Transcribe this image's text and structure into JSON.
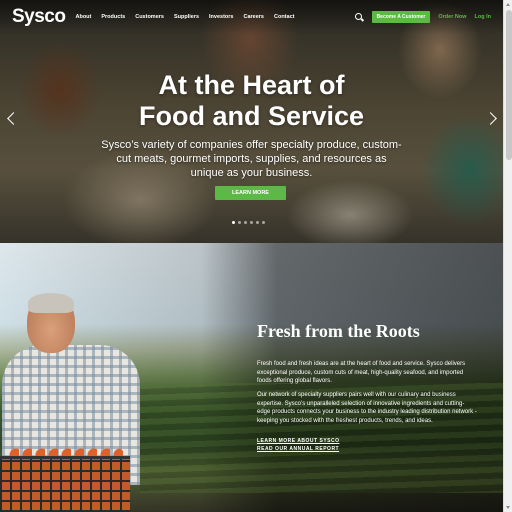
{
  "nav": {
    "logo": "Sysco",
    "links": [
      "About",
      "Products",
      "Customers",
      "Suppliers",
      "Investors",
      "Careers",
      "Contact"
    ],
    "become_customer": "Become A Customer",
    "order_now": "Order Now",
    "log_in": "Log In"
  },
  "hero": {
    "title_line1": "At the Heart of",
    "title_line2": "Food and Service",
    "subtitle": "Sysco’s variety of companies offer specialty produce, custom-cut meats, gourmet imports, supplies, and resources as unique as your business.",
    "button": "LEARN MORE",
    "slide_count": 6,
    "active_slide": 1
  },
  "fresh": {
    "title": "Fresh from the Roots",
    "para1": "Fresh food and fresh ideas are at the heart of food and service. Sysco delivers exceptional produce, custom cuts of meat, high-quality seafood, and imported foods offering global flavors.",
    "para2": "Our network of specialty suppliers pairs well with our culinary and business expertise. Sysco’s unparalleled selection of innovative ingredients and cutting-edge products connects your business to the industry leading distribution network - keeping you stocked with the freshest products, trends, and ideas.",
    "link1": "LEARN MORE ABOUT SYSCO",
    "link2": "READ OUR ANNUAL REPORT"
  },
  "colors": {
    "accent": "#5cb946"
  }
}
